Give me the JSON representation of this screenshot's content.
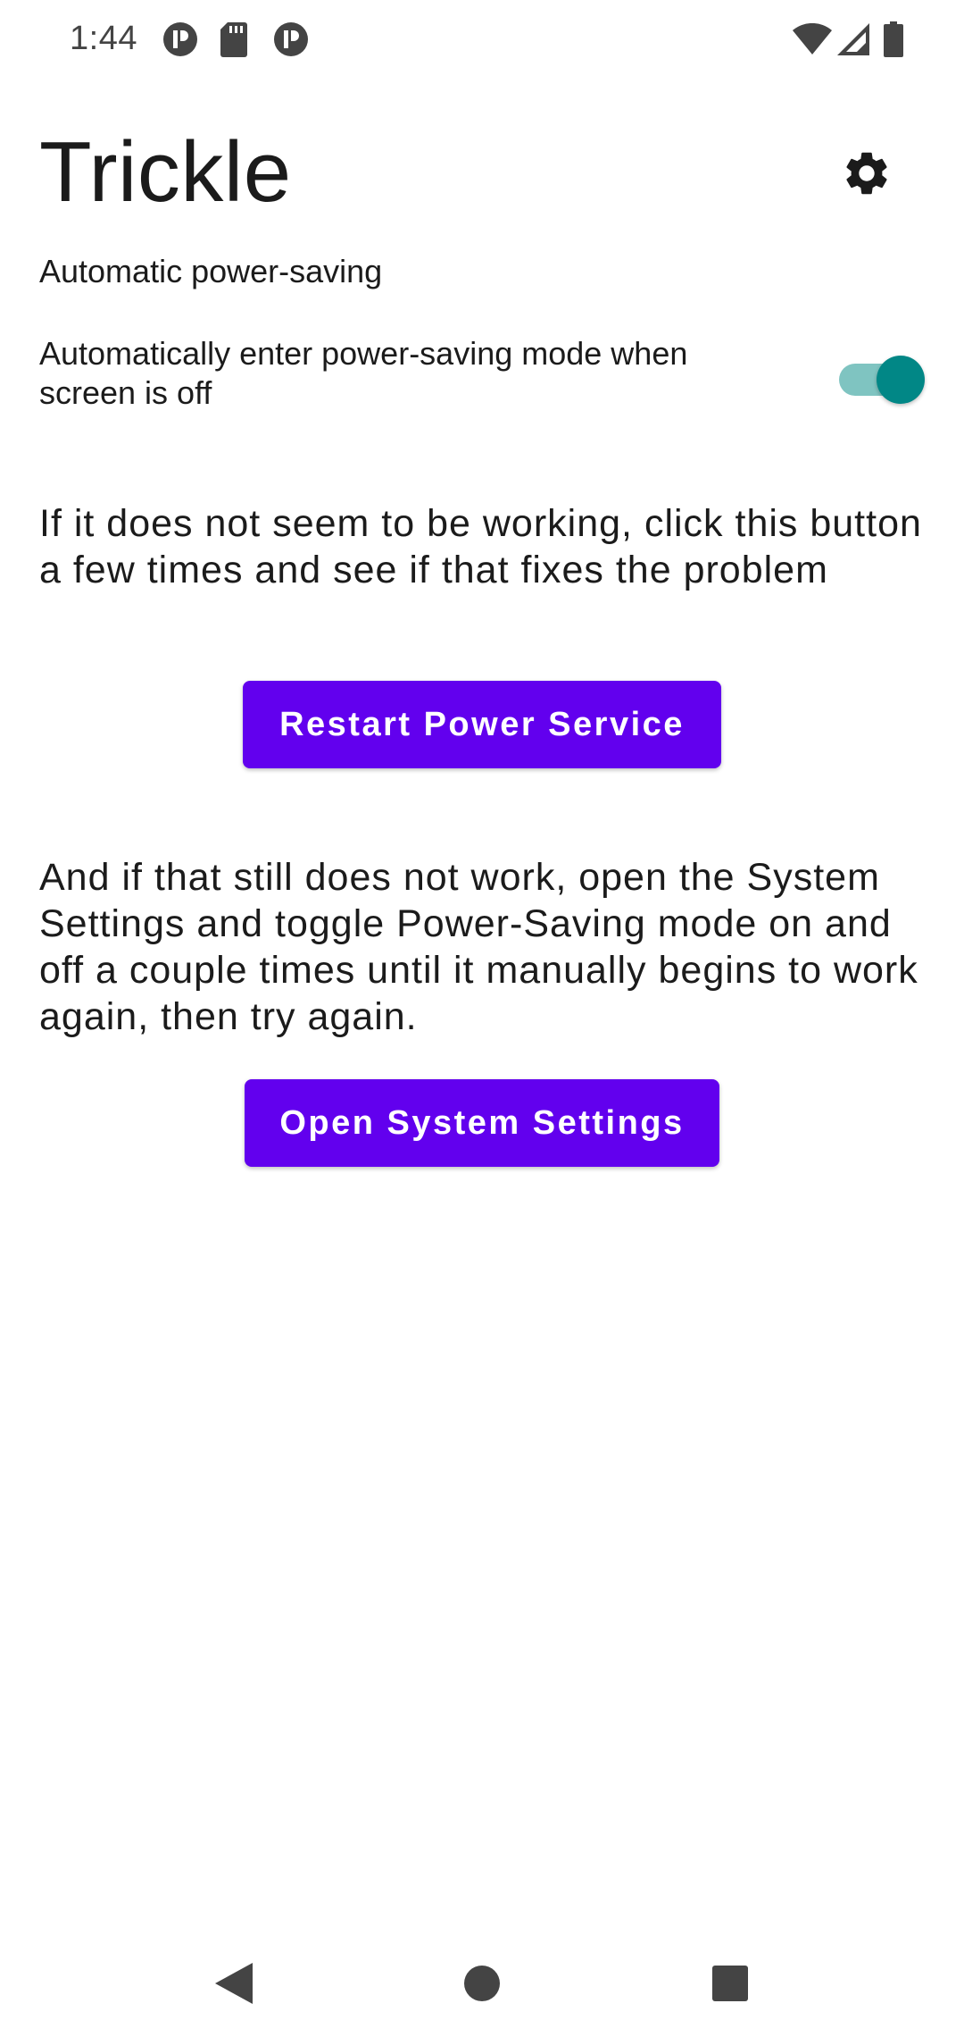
{
  "status_bar": {
    "time": "1:44",
    "icons": [
      "notification-p-icon",
      "sd-card-icon",
      "notification-p-icon",
      "wifi-icon",
      "signal-icon",
      "battery-icon"
    ]
  },
  "header": {
    "title": "Trickle",
    "settings_icon": "gear-icon"
  },
  "auto_section": {
    "label": "Automatic power-saving",
    "toggle_text": "Automatically enter power-saving mode when screen is off",
    "toggle_on": true
  },
  "restart": {
    "description": "If it does not seem to be working, click this button a few times and see if that fixes the problem",
    "button_label": "Restart Power Service"
  },
  "system_settings": {
    "description": "And if that still does not work, open the System Settings and toggle Power-Saving mode on and off a couple times until it manually begins to work again, then try again.",
    "button_label": "Open System Settings"
  },
  "colors": {
    "accent": "#6200ee",
    "switch_thumb": "#018786",
    "switch_track": "#7fc4c1"
  },
  "nav_bar": {
    "icons": [
      "back-icon",
      "home-icon",
      "recents-icon"
    ]
  }
}
